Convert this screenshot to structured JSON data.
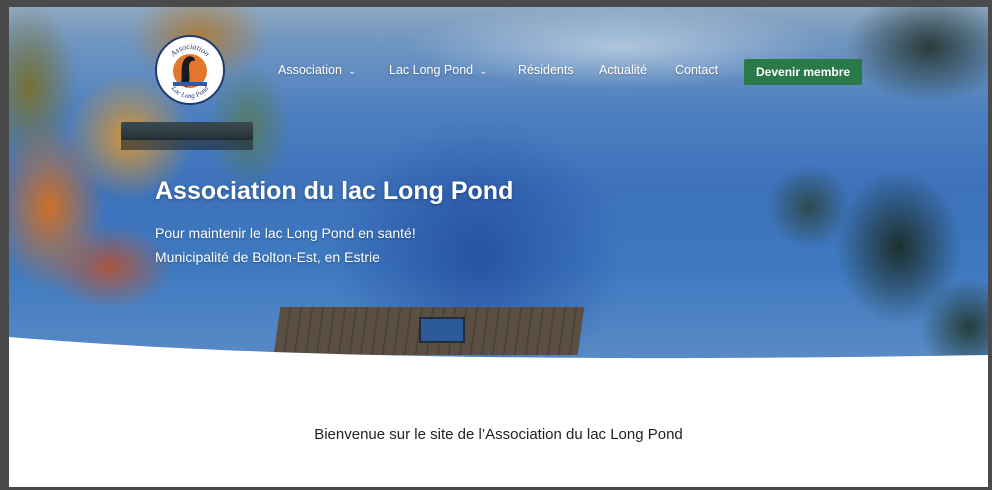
{
  "logo": {
    "text_top": "Association",
    "text_bottom": "Lac Long Pond",
    "colors": {
      "ring": "#1f3a6d",
      "fill": "#e2762c",
      "bird": "#1a1a1a"
    }
  },
  "nav": {
    "items": [
      {
        "label": "Association",
        "has_dropdown": true
      },
      {
        "label": "Lac Long Pond",
        "has_dropdown": true
      },
      {
        "label": "Résidents",
        "has_dropdown": false
      },
      {
        "label": "Actualité",
        "has_dropdown": false
      },
      {
        "label": "Contact",
        "has_dropdown": false
      }
    ],
    "cta_label": "Devenir membre",
    "chevron_icon": "chevron-down-icon"
  },
  "hero": {
    "title": "Association du lac Long Pond",
    "line1": "Pour maintenir le lac Long Pond en santé!",
    "line2": "Municipalité de Bolton-Est, en Estrie"
  },
  "content": {
    "welcome": "Bienvenue sur le site de l’Association du lac Long Pond"
  },
  "colors": {
    "cta_bg": "#2a7a49",
    "lake": "#3d72bb",
    "text": "#222222"
  }
}
